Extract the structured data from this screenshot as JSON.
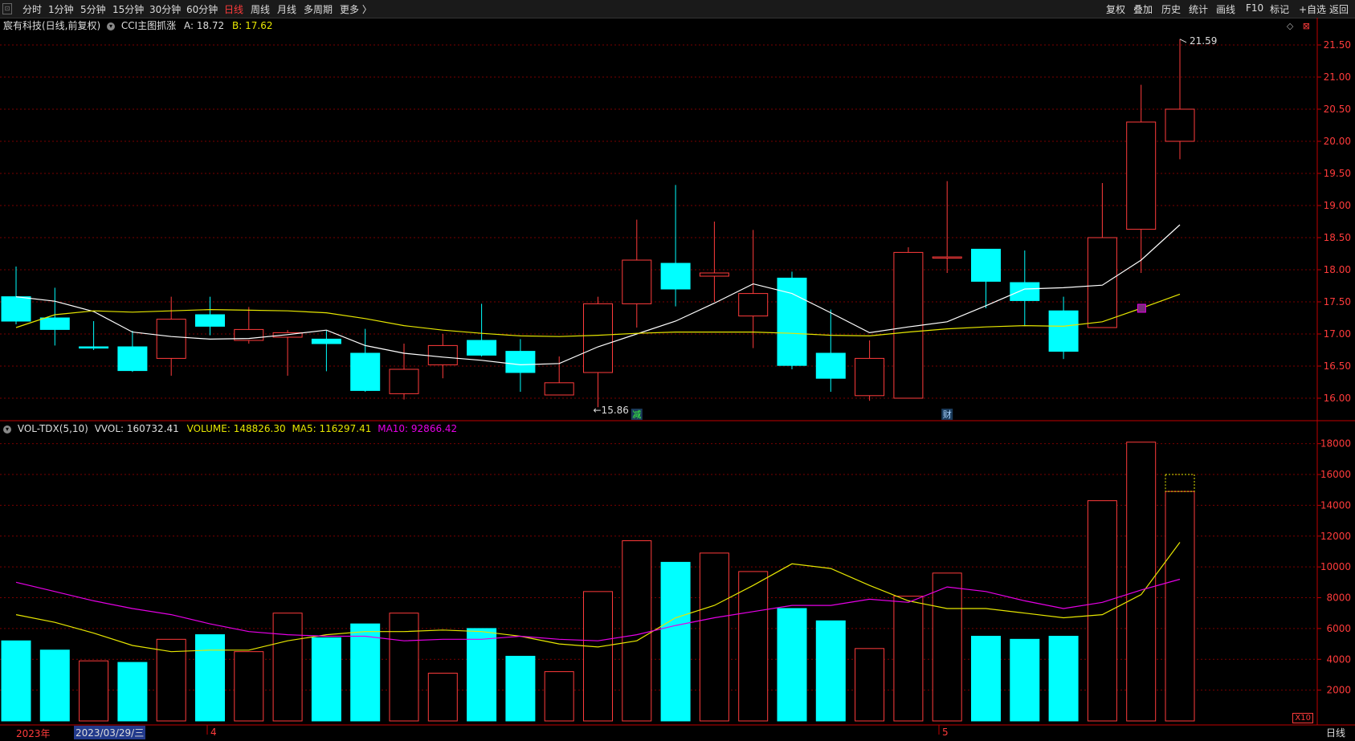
{
  "toolbar": {
    "periods": [
      "分时",
      "1分钟",
      "5分钟",
      "15分钟",
      "30分钟",
      "60分钟",
      "日线",
      "周线",
      "月线",
      "多周期",
      "更多 〉"
    ],
    "active_period": "日线",
    "right_items": [
      "复权",
      "叠加",
      "历史",
      "统计",
      "画线",
      "F10",
      "标记",
      "+自选",
      "返回"
    ]
  },
  "price_header": {
    "title": "宸有科技(日线,前复权)",
    "indicator": "CCI主图抓涨",
    "a_label": "A: 18.72",
    "b_label": "B: 17.62"
  },
  "volume_header": {
    "indicator": "VOL-TDX(5,10)",
    "vvol": "VVOL: 160732.41",
    "volume": "VOLUME: 148826.30",
    "ma5": "MA5: 116297.41",
    "ma10": "MA10: 92866.42"
  },
  "colors": {
    "up": "#ff3b3b",
    "down": "#00ffff",
    "ma_short": "#ffffff",
    "ma_long": "#e6e600",
    "vol_ma5": "#e6e600",
    "vol_ma10": "#e600e6",
    "grid": "#7a0000",
    "axis_text": "#ff3b3b"
  },
  "chart_data": [
    {
      "type": "candlestick",
      "ylim": [
        15.7,
        21.7
      ],
      "yticks": [
        "16.00",
        "16.50",
        "17.00",
        "17.50",
        "18.00",
        "18.50",
        "19.00",
        "19.50",
        "20.00",
        "20.50",
        "21.00",
        "21.50"
      ],
      "candles": [
        {
          "o": 17.58,
          "c": 17.2,
          "h": 18.05,
          "l": 17.15
        },
        {
          "o": 17.25,
          "c": 17.07,
          "h": 17.72,
          "l": 16.82
        },
        {
          "o": 16.8,
          "c": 16.78,
          "h": 17.2,
          "l": 16.75
        },
        {
          "o": 16.8,
          "c": 16.43,
          "h": 17.05,
          "l": 16.41
        },
        {
          "o": 16.62,
          "c": 17.23,
          "h": 17.58,
          "l": 16.35
        },
        {
          "o": 17.3,
          "c": 17.12,
          "h": 17.58,
          "l": 16.98
        },
        {
          "o": 16.9,
          "c": 17.07,
          "h": 17.42,
          "l": 16.85
        },
        {
          "o": 16.95,
          "c": 17.02,
          "h": 17.06,
          "l": 16.35
        },
        {
          "o": 16.92,
          "c": 16.85,
          "h": 17.05,
          "l": 16.42
        },
        {
          "o": 16.7,
          "c": 16.12,
          "h": 17.08,
          "l": 16.1
        },
        {
          "o": 16.07,
          "c": 16.45,
          "h": 16.85,
          "l": 15.98
        },
        {
          "o": 16.52,
          "c": 16.82,
          "h": 17.0,
          "l": 16.31
        },
        {
          "o": 16.9,
          "c": 16.67,
          "h": 17.47,
          "l": 16.65
        },
        {
          "o": 16.73,
          "c": 16.4,
          "h": 16.92,
          "l": 16.1
        },
        {
          "o": 16.05,
          "c": 16.24,
          "h": 16.65,
          "l": 16.05
        },
        {
          "o": 16.4,
          "c": 17.47,
          "h": 17.58,
          "l": 15.86
        },
        {
          "o": 17.47,
          "c": 18.15,
          "h": 18.78,
          "l": 17.1
        },
        {
          "o": 18.1,
          "c": 17.7,
          "h": 19.32,
          "l": 17.43
        },
        {
          "o": 17.9,
          "c": 17.95,
          "h": 18.75,
          "l": 17.5
        },
        {
          "o": 17.28,
          "c": 17.63,
          "h": 18.62,
          "l": 16.78
        },
        {
          "o": 17.87,
          "c": 16.51,
          "h": 17.97,
          "l": 16.45
        },
        {
          "o": 16.7,
          "c": 16.31,
          "h": 17.38,
          "l": 16.1
        },
        {
          "o": 16.04,
          "c": 16.62,
          "h": 16.9,
          "l": 15.96
        },
        {
          "o": 16.0,
          "c": 18.27,
          "h": 18.35,
          "l": 16.0
        },
        {
          "o": 18.2,
          "c": 18.2,
          "h": 19.38,
          "l": 17.95
        },
        {
          "o": 18.32,
          "c": 17.82,
          "h": 18.32,
          "l": 17.4
        },
        {
          "o": 17.8,
          "c": 17.52,
          "h": 18.3,
          "l": 17.12
        },
        {
          "o": 17.36,
          "c": 16.73,
          "h": 17.58,
          "l": 16.61
        },
        {
          "o": 17.1,
          "c": 18.5,
          "h": 19.35,
          "l": 17.1
        },
        {
          "o": 18.63,
          "c": 20.3,
          "h": 20.88,
          "l": 17.95
        },
        {
          "o": 20.0,
          "c": 20.5,
          "h": 21.59,
          "l": 19.72
        }
      ],
      "ma_short": [
        17.58,
        17.51,
        17.35,
        17.03,
        16.96,
        16.92,
        16.93,
        16.99,
        17.06,
        16.82,
        16.7,
        16.64,
        16.59,
        16.52,
        16.54,
        16.8,
        17.0,
        17.2,
        17.48,
        17.78,
        17.63,
        17.33,
        17.02,
        17.11,
        17.19,
        17.44,
        17.7,
        17.72,
        17.76,
        18.15,
        18.7
      ],
      "ma_long": [
        17.1,
        17.3,
        17.36,
        17.34,
        17.36,
        17.38,
        17.37,
        17.36,
        17.33,
        17.24,
        17.13,
        17.06,
        17.01,
        16.97,
        16.96,
        16.98,
        17.01,
        17.03,
        17.03,
        17.03,
        17.01,
        16.98,
        16.97,
        17.03,
        17.08,
        17.11,
        17.13,
        17.12,
        17.19,
        17.4,
        17.62
      ],
      "annotations": [
        {
          "text": "←15.86",
          "index": 15,
          "value": 15.86
        },
        {
          "text": "21.59",
          "index": 30,
          "value": 21.59
        },
        {
          "text": "减",
          "index": 16
        },
        {
          "text": "财",
          "index": 24
        }
      ]
    },
    {
      "type": "bar",
      "title": "VOL-TDX(5,10)",
      "ylim": [
        0,
        18400
      ],
      "yticks": [
        "2000",
        "4000",
        "6000",
        "8000",
        "10000",
        "12000",
        "14000",
        "16000",
        "18000"
      ],
      "volumes": [
        5200,
        4600,
        3900,
        3800,
        5300,
        5600,
        4500,
        7000,
        5400,
        6300,
        7000,
        3100,
        6000,
        4200,
        3200,
        8400,
        11700,
        10300,
        10900,
        9700,
        7300,
        6500,
        4700,
        8100,
        9600,
        5500,
        5300,
        5500,
        14300,
        18100,
        14900
      ],
      "volume_dir": [
        "down",
        "down",
        "up",
        "down",
        "up",
        "down",
        "up",
        "up",
        "down",
        "down",
        "up",
        "up",
        "down",
        "down",
        "up",
        "up",
        "up",
        "down",
        "up",
        "up",
        "down",
        "down",
        "up",
        "up",
        "up",
        "down",
        "down",
        "down",
        "up",
        "up",
        "up"
      ],
      "forecast_top": 16000,
      "ma5": [
        6900,
        6400,
        5700,
        4900,
        4500,
        4600,
        4600,
        5200,
        5600,
        5800,
        5800,
        5900,
        5800,
        5500,
        5000,
        4800,
        5200,
        6700,
        7500,
        8800,
        10200,
        9900,
        8800,
        7800,
        7300,
        7300,
        7000,
        6700,
        6900,
        8200,
        11600
      ],
      "ma10": [
        9000,
        8400,
        7800,
        7300,
        6900,
        6300,
        5800,
        5600,
        5500,
        5500,
        5200,
        5300,
        5300,
        5500,
        5300,
        5200,
        5600,
        6200,
        6700,
        7100,
        7500,
        7500,
        7900,
        7700,
        8700,
        8400,
        7800,
        7300,
        7700,
        8500,
        9200
      ]
    }
  ],
  "x_axis": {
    "year_label": "2023年",
    "date_tag": "2023/03/29/三",
    "month_apr": "4",
    "month_may": "5",
    "mode": "日线",
    "zoom": "X10"
  }
}
